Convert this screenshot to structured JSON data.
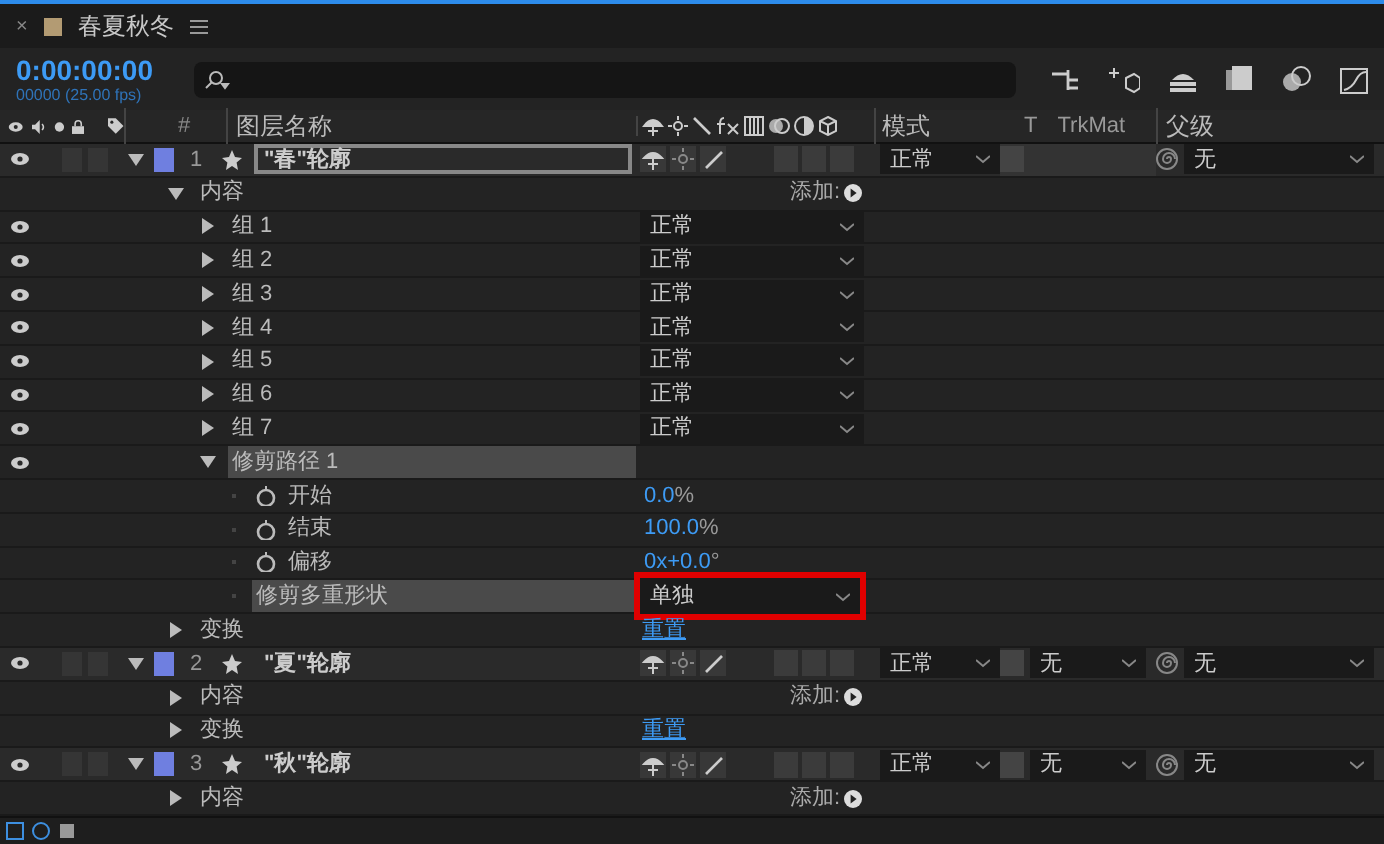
{
  "tab": {
    "close": "×",
    "title": "春夏秋冬"
  },
  "timecode": "0:00:00:00",
  "fps": "00000 (25.00 fps)",
  "columns": {
    "number": "#",
    "layer_name": "图层名称",
    "mode": "模式",
    "t": "T",
    "trkmat": "TrkMat",
    "parent": "父级"
  },
  "layers": [
    {
      "kind": "layer",
      "number": "1",
      "name": "\"春\"轮廓",
      "color": "#6f7fe0",
      "selected": true,
      "expanded": true,
      "eye": true,
      "mode": "正常",
      "parent": "无",
      "children": [
        {
          "kind": "contents",
          "label": "内容",
          "expanded": true,
          "action": "添加:",
          "children": [
            {
              "kind": "group",
              "label": "组 1",
              "eye": true,
              "expanded": false,
              "blend": "正常"
            },
            {
              "kind": "group",
              "label": "组 2",
              "eye": true,
              "expanded": false,
              "blend": "正常"
            },
            {
              "kind": "group",
              "label": "组 3",
              "eye": true,
              "expanded": false,
              "blend": "正常"
            },
            {
              "kind": "group",
              "label": "组 4",
              "eye": true,
              "expanded": false,
              "blend": "正常"
            },
            {
              "kind": "group",
              "label": "组 5",
              "eye": true,
              "expanded": false,
              "blend": "正常"
            },
            {
              "kind": "group",
              "label": "组 6",
              "eye": true,
              "expanded": false,
              "blend": "正常"
            },
            {
              "kind": "group",
              "label": "组 7",
              "eye": true,
              "expanded": false,
              "blend": "正常"
            },
            {
              "kind": "trim",
              "label": "修剪路径 1",
              "eye": true,
              "expanded": true,
              "children": [
                {
                  "kind": "property",
                  "label": "开始",
                  "value": "0.0",
                  "unit": "%"
                },
                {
                  "kind": "property",
                  "label": "结束",
                  "value": "100.0",
                  "unit": "%"
                },
                {
                  "kind": "property",
                  "label": "偏移",
                  "value": "0x+0.0",
                  "unit": "°"
                },
                {
                  "kind": "option",
                  "label": "修剪多重形状",
                  "dropdown": "单独",
                  "highlighted": true
                }
              ]
            }
          ]
        },
        {
          "kind": "transform",
          "label": "变换",
          "expanded": false,
          "action": "重置"
        }
      ]
    },
    {
      "kind": "layer",
      "number": "2",
      "name": "\"夏\"轮廓",
      "color": "#6f7fe0",
      "selected": false,
      "expanded": true,
      "eye": true,
      "mode": "正常",
      "trkmat": "无",
      "parent": "无",
      "children": [
        {
          "kind": "contents",
          "label": "内容",
          "expanded": false,
          "action": "添加:"
        },
        {
          "kind": "transform",
          "label": "变换",
          "expanded": false,
          "action": "重置"
        }
      ]
    },
    {
      "kind": "layer",
      "number": "3",
      "name": "\"秋\"轮廓",
      "color": "#6f7fe0",
      "selected": false,
      "expanded": true,
      "eye": true,
      "mode": "正常",
      "trkmat": "无",
      "parent": "无",
      "children": [
        {
          "kind": "contents",
          "label": "内容",
          "expanded": false,
          "action": "添加:"
        }
      ]
    }
  ]
}
